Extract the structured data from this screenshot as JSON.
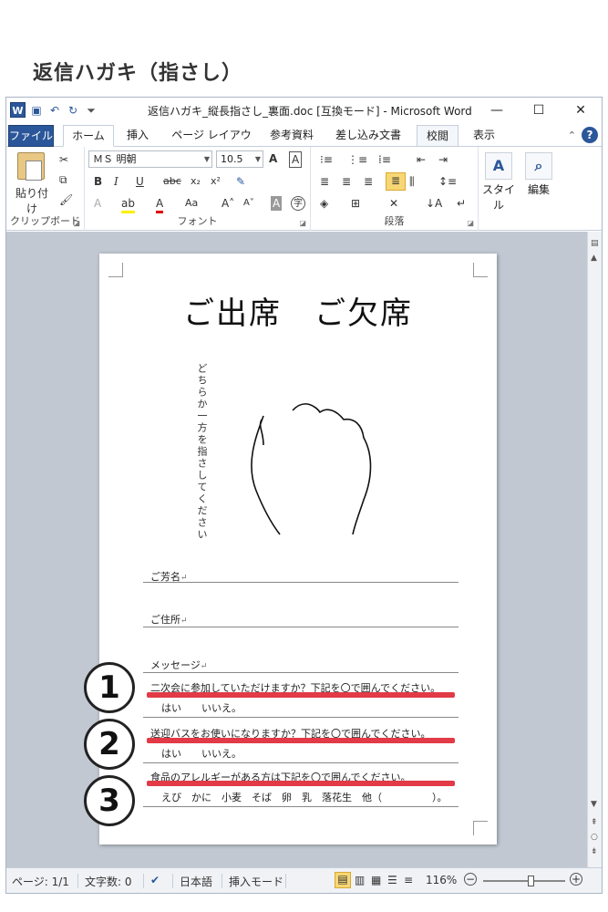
{
  "heading": "返信ハガキ（指さし）",
  "window": {
    "title": "返信ハガキ_縦長指さし_裏面.doc [互換モード] - Microsoft Word",
    "controls": [
      "—",
      "☐",
      "✕"
    ]
  },
  "qat": {
    "logo": "W",
    "save_icon": "save-icon",
    "undo_icon": "undo-icon",
    "redo_icon": "redo-icon"
  },
  "tabs": [
    "ファイル",
    "ホーム",
    "挿入",
    "ページ レイアウト",
    "参考資料",
    "差し込み文書",
    "校閲",
    "表示"
  ],
  "ribbon": {
    "clipboard": {
      "paste": "貼り付け",
      "label": "クリップボード"
    },
    "font": {
      "font_name": "ＭＳ 明朝",
      "font_size": "10.5",
      "label": "フォント"
    },
    "paragraph": {
      "label": "段落"
    },
    "styles": {
      "label": "スタイル"
    },
    "editing": {
      "label": "編集"
    }
  },
  "document": {
    "title": "ご出席　ご欠席",
    "vertical_instruction": "どちらか一方を指さしてください",
    "name_label": "ご芳名",
    "address_label": "ご住所",
    "message_label": "メッセージ",
    "questions": [
      {
        "text": "二次会に参加していただけますか？下記を〇で囲んでください。",
        "answers": "はい　　いいえ。"
      },
      {
        "text": "送迎バスをお使いになりますか？下記を〇で囲んでください。",
        "answers": "はい　　いいえ。"
      },
      {
        "text": "食品のアレルギーがある方は下記を〇で囲んでください。",
        "answers": "えび　かに　小麦　そば　卵　乳　落花生　他（　　　　　）。"
      }
    ],
    "markers": [
      "1",
      "2",
      "3"
    ],
    "highlight_color": "#e23a46"
  },
  "statusbar": {
    "page": "ページ: 1/1",
    "words": "文字数: 0",
    "language": "日本語",
    "mode": "挿入モード",
    "zoom": "116%",
    "zoom_level": 0.58
  }
}
